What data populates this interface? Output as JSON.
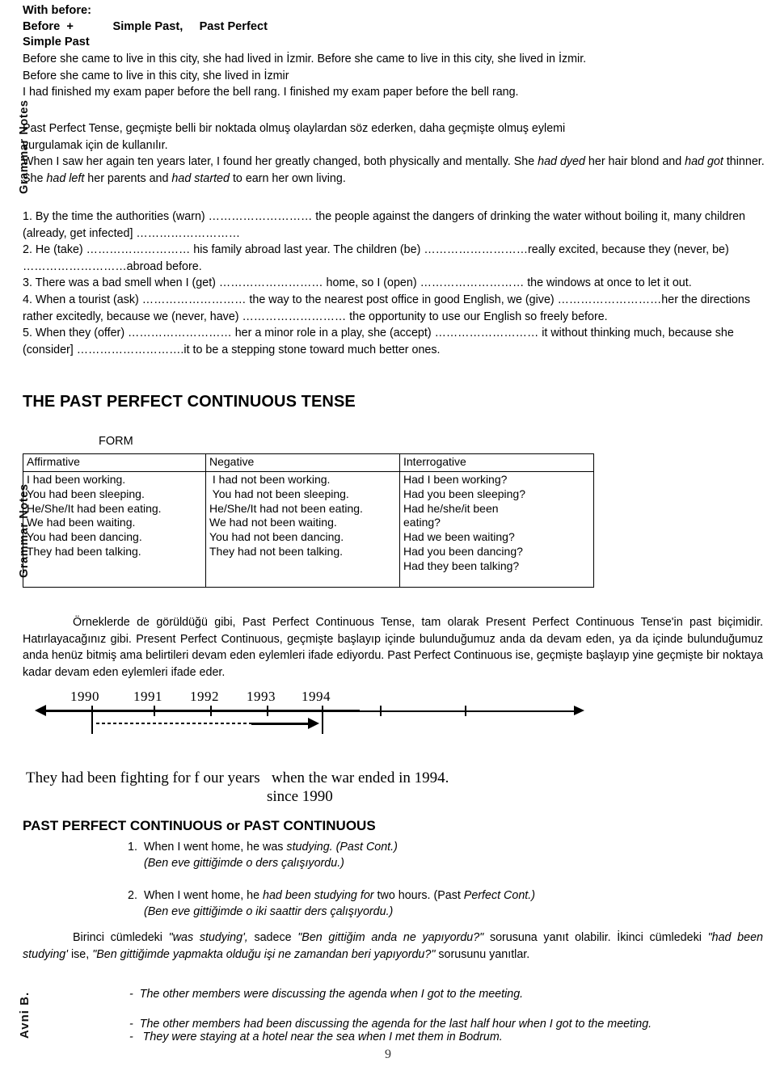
{
  "side_labels": {
    "grammar_notes": "Grammar Notes",
    "author": "Avni B."
  },
  "header": {
    "line1": "With before:",
    "line2": "Before  +            Simple Past,     Past Perfect",
    "line3": "Simple Past"
  },
  "examples_before": {
    "line1": "Before she came to live in this city, she had lived in İzmir. Before she came to live in this city, she lived in İzmir.",
    "line2": "Before she came to live in this city, she lived in İzmir",
    "line3": "I had finished my exam paper before the bell rang. I finished my exam paper before the bell rang."
  },
  "turkish_note": {
    "line1": "Past Perfect Tense, geçmişte belli bir noktada olmuş olaylardan söz ederken, daha geçmişte olmuş eylemi",
    "line2": "vurgulamak için de kullanılır."
  },
  "english_example": {
    "part1": "When I saw her again ten years later, I found her greatly changed, both physically and mentally. She ",
    "it1": "had dyed",
    "part2": " her hair blond and ",
    "it2": "had got",
    "part3": " thinner. She ",
    "it3": "had left",
    "part4": " her parents and ",
    "it4": "had started",
    "part5": " to earn her own living."
  },
  "exercises": [
    "1. By the time the authorities (warn) ……………………… the people against the dangers of drinking the water without boiling it, many children (already, get infected] ………………………",
    "2. He (take) ………………………  his family abroad last year. The children (be) ………………………really excited, because they (never, be) ………………………abroad before.",
    "3. There was a bad smell when I (get) ………………………  home, so I (open) ……………………… the windows at once to let it out.",
    "4. When a tourist (ask) ………………………  the way to the nearest post office in good English, we (give) ………………………her the directions rather excitedly, because we (never, have) ……………………… the opportunity to use our English so freely before.",
    "5. When they (offer) ……………………… her a minor role in a play, she (accept) ……………………… it without thinking much, because she (consider]      ……………………….it to be a stepping stone toward much better ones."
  ],
  "section_past_perfect_continuous": {
    "title": "THE PAST PERFECT CONTINUOUS TENSE",
    "form_label": "FORM"
  },
  "form_table": {
    "headers": [
      "Affirmative",
      "Negative",
      "Interrogative"
    ],
    "columns": [
      [
        "I had been working.",
        "You had been sleeping.",
        "He/She/It had been eating.",
        "We had been waiting.",
        "You had been dancing.",
        "They had been talking."
      ],
      [
        " I had not been working.",
        " You had not been sleeping.",
        "He/She/It had not been eating.",
        "We had not been waiting.",
        "You had not been dancing.",
        "They had not been talking."
      ],
      [
        "Had I been working?",
        "Had you been sleeping?",
        "Had he/she/it been",
        "eating?",
        "Had we been waiting?",
        "Had you been dancing?",
        "Had they been talking?"
      ]
    ]
  },
  "turkish_paragraph": {
    "text": "Örneklerde de görüldüğü gibi, Past Perfect Continuous Tense, tam olarak Present Perfect Continuous Tense'in past biçimidir. Hatırlayacağınız gibi. Present Perfect Continuous, geçmişte başlayıp içinde bulunduğumuz anda da devam eden, ya da içinde bulunduğumuz anda henüz bitmiş ama belirtileri devam eden eylemleri ifade ediyordu. Past Perfect Continuous ise, geçmişte başlayıp yine geçmişte bir noktaya kadar devam eden eylemleri ifade eder."
  },
  "timeline": {
    "years": [
      "1990",
      "1991",
      "1992",
      "1993",
      "1994"
    ],
    "sentence": "They had been fighting for f our years   when the war ended in 1994.",
    "since": "since 1990"
  },
  "section_comparison": {
    "title": "PAST PERFECT CONTINUOUS or PAST CONTINUOUS",
    "items": [
      {
        "number": "1.",
        "en_pre": "When I went home, he was ",
        "en_it": "studying. (Past Cont.)",
        "tr": "(Ben eve gittiğimde o ders çalışıyordu.)"
      },
      {
        "number": "2.",
        "en_pre": "When I went home, he ",
        "en_it": "had been studying for",
        "en_mid": " two hours. (Past ",
        "en_it2": "Perfect Cont.)",
        "tr": "(Ben eve gittiğimde o iki saattir ders çalışıyordu.)"
      }
    ]
  },
  "explanation": {
    "p1_a": "Birinci cümledeki ",
    "p1_q1": "\"was studying',",
    "p1_b": " sadece ",
    "p1_q2": "\"Ben gittiğim anda ne yapıyordu?\"",
    "p1_c": " sorusuna yanıt olabilir. İkinci cümledeki ",
    "p1_q3": "\"had been studying'",
    "p1_d": " ise, ",
    "p1_q4": "\"Ben gittiğimde yapmakta olduğu işi ne zamandan beri yapıyordu?\"",
    "p1_e": " sorusunu yanıtlar."
  },
  "dash_examples": [
    "-  The other members were discussing the agenda when I got to the meeting.",
    "-  The other members had been discussing the agenda for the last half hour when I got to the meeting.",
    "-   They were staying at a hotel near the sea when I met them in Bodrum."
  ],
  "page_number": "9"
}
